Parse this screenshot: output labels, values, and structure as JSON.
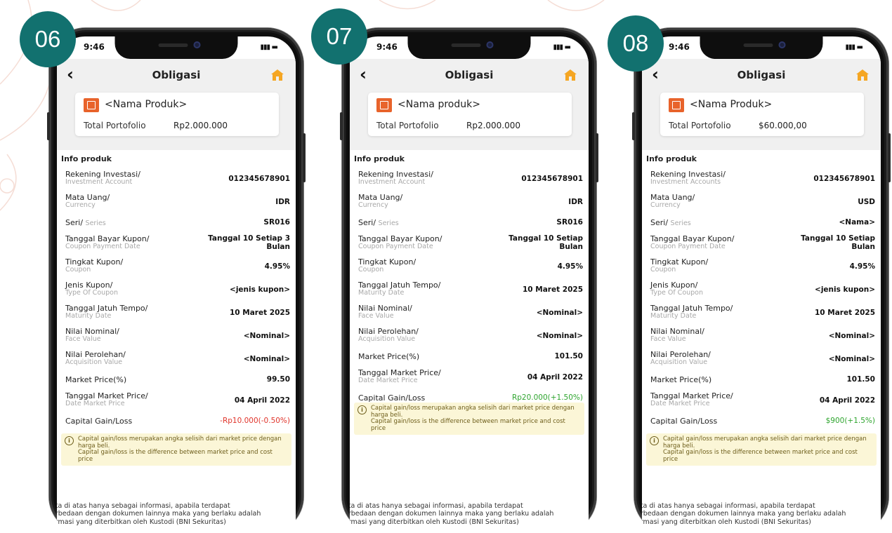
{
  "screens": [
    {
      "badge": "06",
      "time": "9:46",
      "title": "Obligasi",
      "product_name": "<Nama Produk>",
      "total_label": "Total Portofolio",
      "total_value": "Rp2.000.000",
      "info_title": "Info produk",
      "rows": [
        {
          "label": "Rekening Investasi/",
          "sub": "Investment Account",
          "value": "012345678901"
        },
        {
          "label": "Mata Uang/",
          "sub": "Currency",
          "value": "IDR"
        },
        {
          "label": "Seri/",
          "sub": "Series",
          "value": "SR016"
        },
        {
          "label": "Tanggal Bayar Kupon/",
          "sub": "Coupon Payment Date",
          "value": "Tanggal 10 Setiap 3",
          "value2": "Bulan"
        },
        {
          "label": "Tingkat Kupon/",
          "sub": "Coupon",
          "value": "4.95%"
        },
        {
          "label": "Jenis Kupon/",
          "sub": "Type Of Coupon",
          "value": "<jenis kupon>"
        },
        {
          "label": "Tanggal Jatuh Tempo/",
          "sub": "Maturity Date",
          "value": "10 Maret 2025"
        },
        {
          "label": "Nilai Nominal/",
          "sub": "Face Value",
          "value": "<Nominal>"
        },
        {
          "label": "Nilai Perolehan/",
          "sub": "Acquisition Value",
          "value": "<Nominal>"
        },
        {
          "label": "Market Price(%)",
          "sub": "",
          "value": "99.50"
        },
        {
          "label": "Tanggal Market Price/",
          "sub": "Date Market Price",
          "value": "04 April 2022"
        },
        {
          "label": "Capital Gain/Loss",
          "sub": "",
          "value": "-Rp10.000(-0.50%)",
          "tone": "red"
        }
      ],
      "note_line1": "Capital gain/loss merupakan angka selisih dari market price dengan harga beli.",
      "note_line2": "Capital gain/loss is the difference between market price and cost price",
      "footer": [
        "ata di atas hanya sebagai informasi, apabila terdapat",
        "erbedaan dengan dokumen lainnya maka yang berlaku adalah",
        "ormasi yang diterbitkan oleh Kustodi (BNI Sekuritas)"
      ]
    },
    {
      "badge": "07",
      "time": "9:46",
      "title": "Obligasi",
      "product_name": "<Nama produk>",
      "total_label": "Total Portofolio",
      "total_value": "Rp2.000.000",
      "info_title": "Info produk",
      "rows": [
        {
          "label": "Rekening Investasi/",
          "sub": "Investment Account",
          "value": "012345678901"
        },
        {
          "label": "Mata Uang/",
          "sub": "Currency",
          "value": "IDR"
        },
        {
          "label": "Seri/",
          "sub": "Series",
          "value": "SR016"
        },
        {
          "label": "Tanggal Bayar Kupon/",
          "sub": "Coupon Payment Date",
          "value": "Tanggal 10 Setiap",
          "value2": "Bulan"
        },
        {
          "label": "Tingkat Kupon/",
          "sub": "Coupon",
          "value": "4.95%"
        },
        {
          "label": "Tanggal Jatuh Tempo/",
          "sub": "Maturity Date",
          "value": "10 Maret 2025"
        },
        {
          "label": "Nilai Nominal/",
          "sub": "Face Value",
          "value": "<Nominal>"
        },
        {
          "label": "Nilai Perolehan/",
          "sub": "Acquisition Value",
          "value": "<Nominal>"
        },
        {
          "label": "Market Price(%)",
          "sub": "",
          "value": "101.50"
        },
        {
          "label": "Tanggal Market Price/",
          "sub": "Date Market Price",
          "value": "04 April 2022"
        },
        {
          "label": "Capital Gain/Loss",
          "sub": "",
          "value": "Rp20.000(+1.50%)",
          "tone": "green"
        }
      ],
      "note_line1": "Capital gain/loss merupakan angka selisih dari market price dengan harga beli.",
      "note_line2": "Capital gain/loss is the difference between market price and cost price",
      "footer": [
        "ata di atas hanya sebagai informasi, apabila terdapat",
        "erbedaan dengan dokumen lainnya maka yang berlaku adalah",
        "ormasi yang diterbitkan oleh Kustodi (BNI Sekuritas)"
      ]
    },
    {
      "badge": "08",
      "time": "9:46",
      "title": "Obligasi",
      "product_name": "<Nama Produk>",
      "total_label": "Total Portofolio",
      "total_value": "$60.000,00",
      "info_title": "Info produk",
      "rows": [
        {
          "label": "Rekening Investasi/",
          "sub": "Investment Accounts",
          "value": "012345678901"
        },
        {
          "label": "Mata Uang/",
          "sub": "Currency",
          "value": "USD"
        },
        {
          "label": "Seri/",
          "sub": "Series",
          "value": "<Nama>"
        },
        {
          "label": "Tanggal Bayar Kupon/",
          "sub": "Coupon Payment Date",
          "value": "Tanggal 10 Setiap",
          "value2": "Bulan"
        },
        {
          "label": "Tingkat Kupon/",
          "sub": "Coupon",
          "value": "4.95%"
        },
        {
          "label": "Jenis Kupon/",
          "sub": "Type Of Coupon",
          "value": "<jenis kupon>"
        },
        {
          "label": "Tanggal Jatuh Tempo/",
          "sub": "Maturity Date",
          "value": "10 Maret 2025"
        },
        {
          "label": "Nilai Nominal/",
          "sub": "Face Value",
          "value": "<Nominal>"
        },
        {
          "label": "Nilai Perolehan/",
          "sub": "Acquisition Value",
          "value": "<Nominal>"
        },
        {
          "label": "Market Price(%)",
          "sub": "",
          "value": "101.50"
        },
        {
          "label": "Tanggal Market Price/",
          "sub": "Date Market Price",
          "value": "04 April 2022"
        },
        {
          "label": "Capital Gain/Loss",
          "sub": "",
          "value": "$900(+1.5%)",
          "tone": "green"
        }
      ],
      "note_line1": "Capital gain/loss merupakan angka selisih dari market price dengan harga beli.",
      "note_line2": "Capital gain/loss is the difference between market price and cost price",
      "footer": [
        "ata di atas hanya sebagai informasi, apabila terdapat",
        "erbedaan dengan dokumen lainnya maka yang berlaku adalah",
        "ormasi yang diterbitkan oleh Kustodi (BNI Sekuritas)"
      ]
    }
  ]
}
